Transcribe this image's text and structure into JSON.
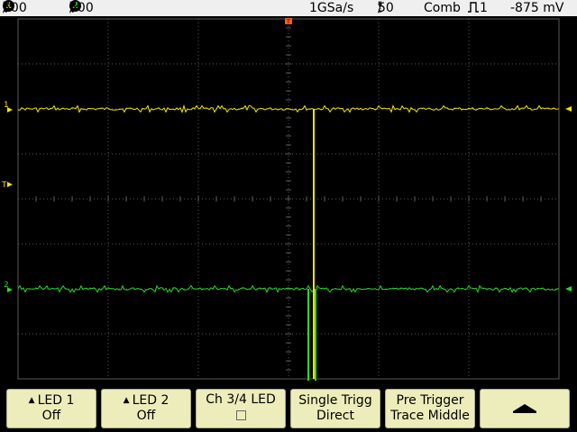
{
  "status": {
    "ch1": {
      "badge": "1",
      "value": "500",
      "unit_top": "m",
      "unit_bottom": "V",
      "color": "#f2e600"
    },
    "ch2": {
      "badge": "2",
      "value": "500",
      "unit_top": "m",
      "unit_bottom": "V",
      "color": "#22d022"
    },
    "sample_rate": "1GSa/s",
    "timebase": {
      "value": "50",
      "unit_top": "n",
      "unit_bottom": "s"
    },
    "trigger_mode": "Comb",
    "trigger_source": "1",
    "trigger_level": "-875 mV"
  },
  "screen": {
    "trace_colors": {
      "ch1": "#f2e600",
      "ch2": "#29d829",
      "trigger": "#ff5a1e",
      "grid": "#5a5a5a"
    },
    "ch1_marker": "1",
    "ch2_marker": "2",
    "trigger_marker": "T"
  },
  "softkeys": [
    {
      "line1": "LED 1",
      "line2": "Off",
      "arrow": "▲"
    },
    {
      "line1": "LED 2",
      "line2": "Off",
      "arrow": "▲"
    },
    {
      "line1": "Ch 3/4 LED",
      "line2": ""
    },
    {
      "line1": "Single Trigg",
      "line2": "Direct"
    },
    {
      "line1": "Pre Trigger",
      "line2": "Trace Middle"
    },
    {
      "line1": "▲",
      "line2": ""
    }
  ]
}
